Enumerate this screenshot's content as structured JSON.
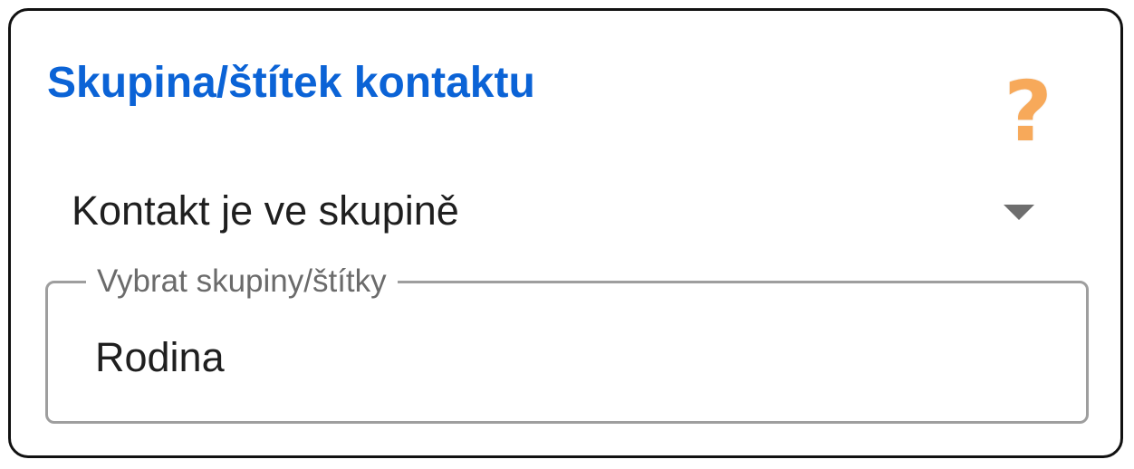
{
  "panel": {
    "title": "Skupina/štítek kontaktu",
    "title_color": "#0b63d6",
    "help_icon": "question-mark-icon",
    "help_glyph": "?",
    "help_color": "#f7a95a"
  },
  "condition_select": {
    "value": "Kontakt je ve skupině",
    "text_color": "#1f1f1f",
    "arrow_icon": "caret-down-icon"
  },
  "groups_field": {
    "label": "Vybrat skupiny/štítky",
    "value": "Rodina",
    "label_color": "#6b6b6b",
    "value_color": "#1f1f1f"
  }
}
